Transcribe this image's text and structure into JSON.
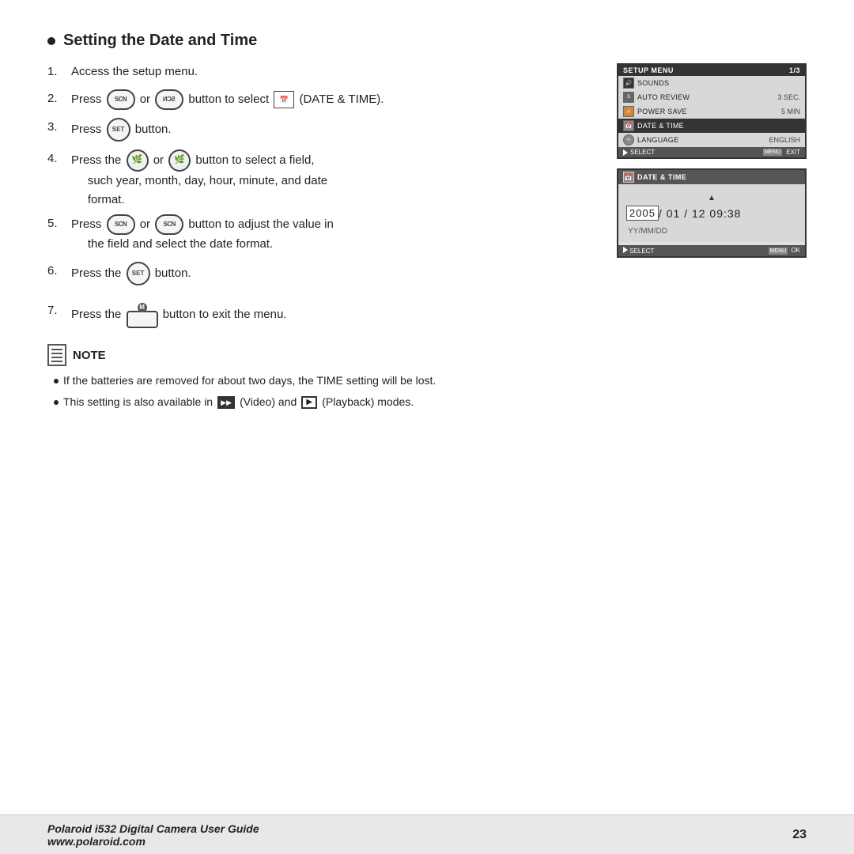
{
  "page": {
    "title": "Setting the Date and Time",
    "footer": {
      "left_line1": "Polaroid i532 Digital Camera User Guide",
      "left_line2": "www.polaroid.com",
      "page_number": "23"
    }
  },
  "steps": [
    {
      "num": "1.",
      "text": "Access the setup menu."
    },
    {
      "num": "2.",
      "text_before": "Press",
      "text_mid": "or",
      "text_after": "button to select",
      "label": "(DATE & TIME)."
    },
    {
      "num": "3.",
      "text_before": "Press",
      "text_after": "button."
    },
    {
      "num": "4.",
      "text": "Press the",
      "text2": "or",
      "text3": "button to select a field, such year, month, day, hour, minute, and date format."
    },
    {
      "num": "5.",
      "text": "Press",
      "text2": "or",
      "text3": "button to adjust the value in the field and select the date format."
    },
    {
      "num": "6.",
      "text": "Press  the",
      "text2": "button."
    },
    {
      "num": "7.",
      "text": "Press the",
      "text2": "button to exit the menu."
    }
  ],
  "setup_menu": {
    "title": "SETUP MENU",
    "page": "1/3",
    "items": [
      {
        "icon": "speaker",
        "label": "SOUNDS",
        "value": ""
      },
      {
        "icon": "S",
        "label": "AUTO REVIEW",
        "value": "3 SEC."
      },
      {
        "icon": "Z",
        "label": "POWER SAVE",
        "value": "5 MIN"
      },
      {
        "icon": "clock",
        "label": "DATE & TIME",
        "value": "",
        "highlighted": true
      },
      {
        "icon": "globe",
        "label": "LANGUAGE",
        "value": "ENGLISH"
      }
    ],
    "footer_left": "SELECT",
    "footer_right": "EXIT"
  },
  "datetime_panel": {
    "title": "DATE & TIME",
    "date_display": "2005 / 01 / 12  09:38",
    "year_highlighted": "2005",
    "rest": " / 01 / 12  09:38",
    "format": "YY/MM/DD",
    "footer_left": "SELECT",
    "footer_right": "OK"
  },
  "note": {
    "title": "NOTE",
    "bullets": [
      "If the batteries are removed for about two days, the TIME setting will be lost.",
      "This setting is also available in  (Video) and  (Playback) modes."
    ]
  }
}
